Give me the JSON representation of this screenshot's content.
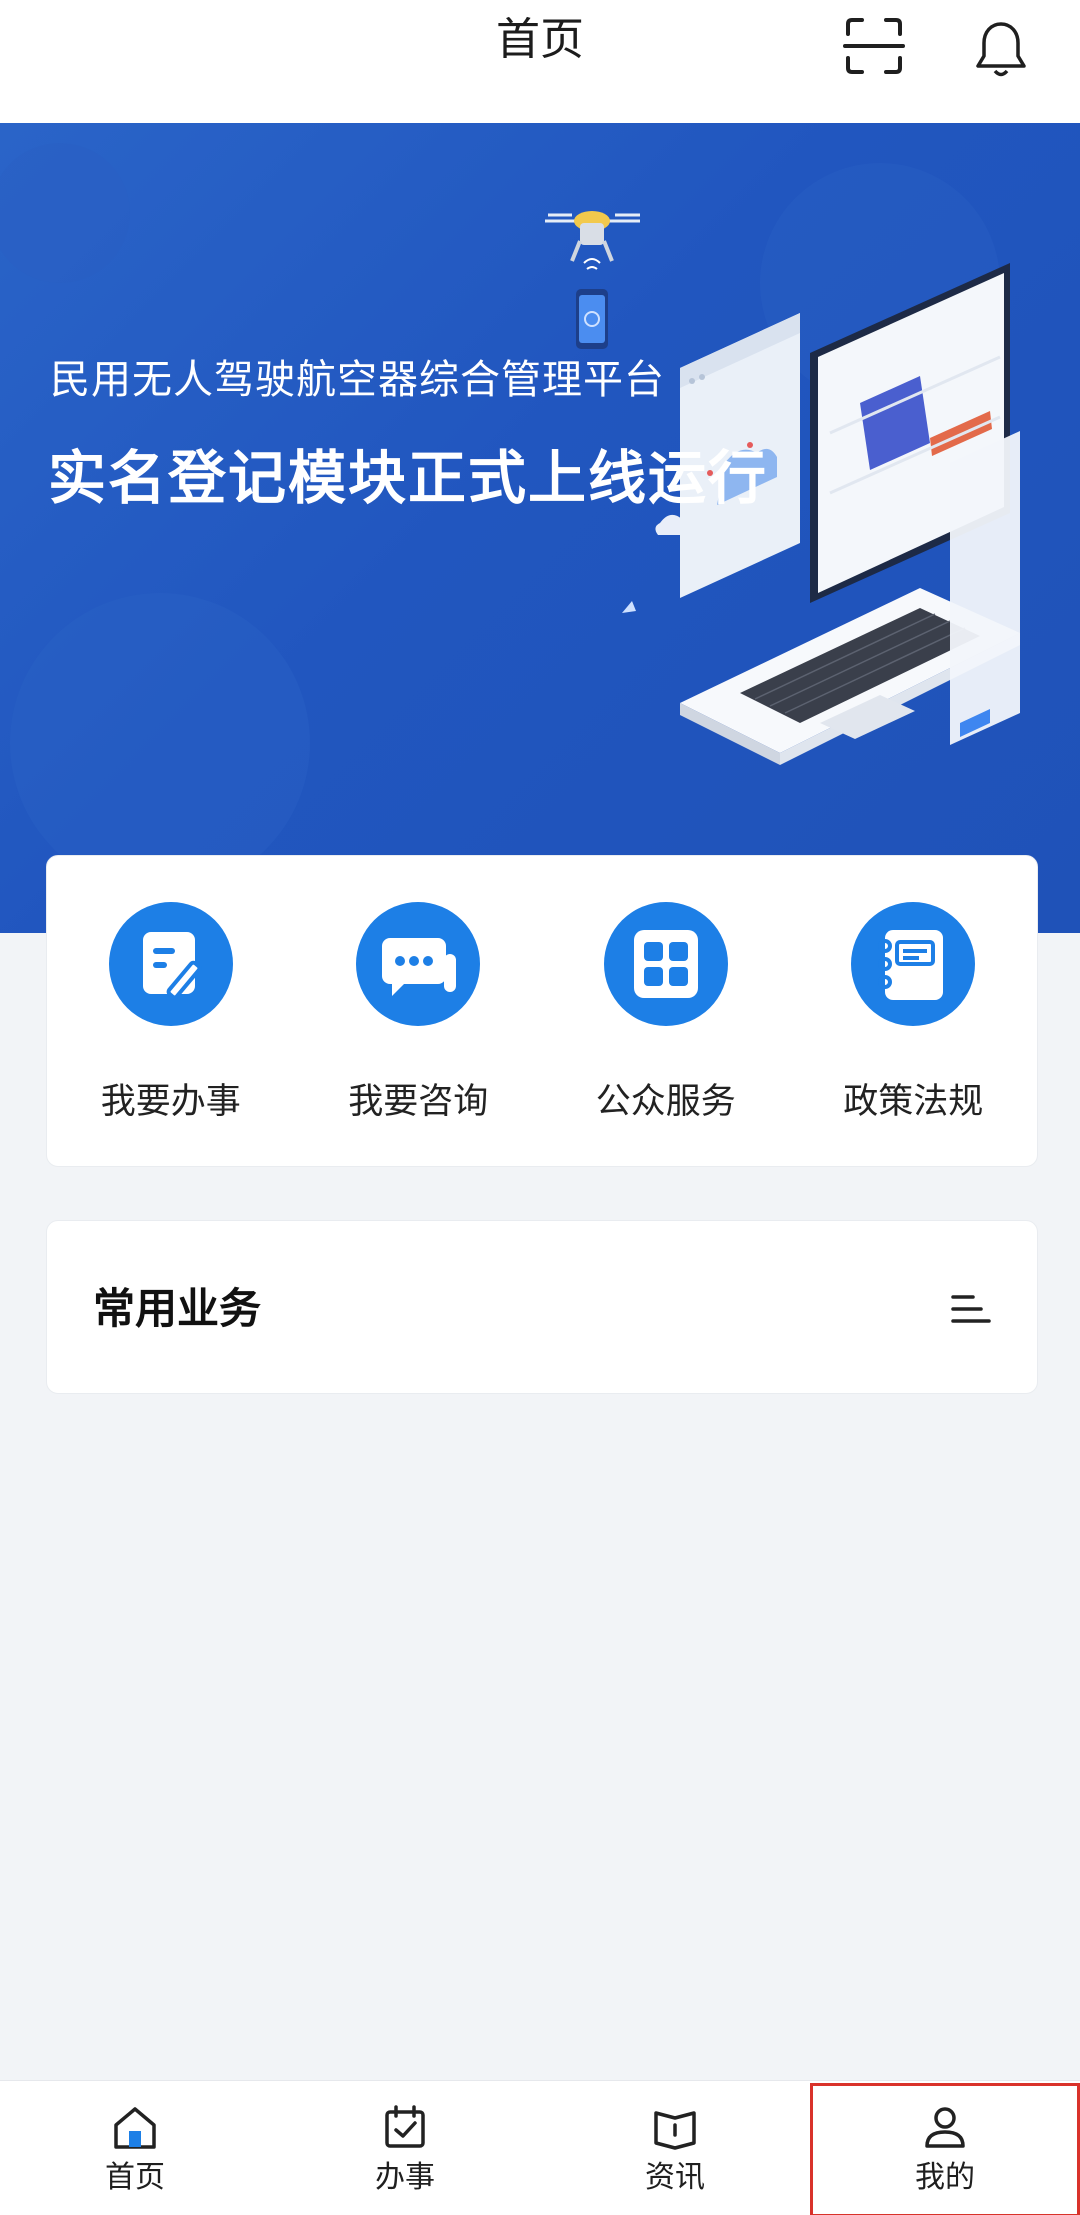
{
  "header": {
    "title": "首页",
    "scan_icon": "scan-icon",
    "bell_icon": "bell-icon"
  },
  "banner": {
    "subtitle": "民用无人驾驶航空器综合管理平台",
    "headline": "实名登记模块正式上线运行",
    "illustration": "laptop-drone-illustration"
  },
  "quick_actions": [
    {
      "label": "我要办事",
      "icon": "form-edit-icon"
    },
    {
      "label": "我要咨询",
      "icon": "chat-bubble-icon"
    },
    {
      "label": "公众服务",
      "icon": "grid-apps-icon"
    },
    {
      "label": "政策法规",
      "icon": "notebook-icon"
    }
  ],
  "common_business": {
    "title": "常用业务",
    "menu_icon": "list-menu-icon"
  },
  "bottom_nav": [
    {
      "label": "首页",
      "icon": "home-icon",
      "active": true
    },
    {
      "label": "办事",
      "icon": "calendar-check-icon",
      "active": false
    },
    {
      "label": "资讯",
      "icon": "book-open-icon",
      "active": false
    },
    {
      "label": "我的",
      "icon": "user-icon",
      "active": false,
      "highlighted": true
    }
  ],
  "colors": {
    "brand_blue": "#1d7fe6",
    "banner_blue": "#2156bf",
    "highlight_red": "#d9322a",
    "page_bg": "#f2f4f7"
  }
}
